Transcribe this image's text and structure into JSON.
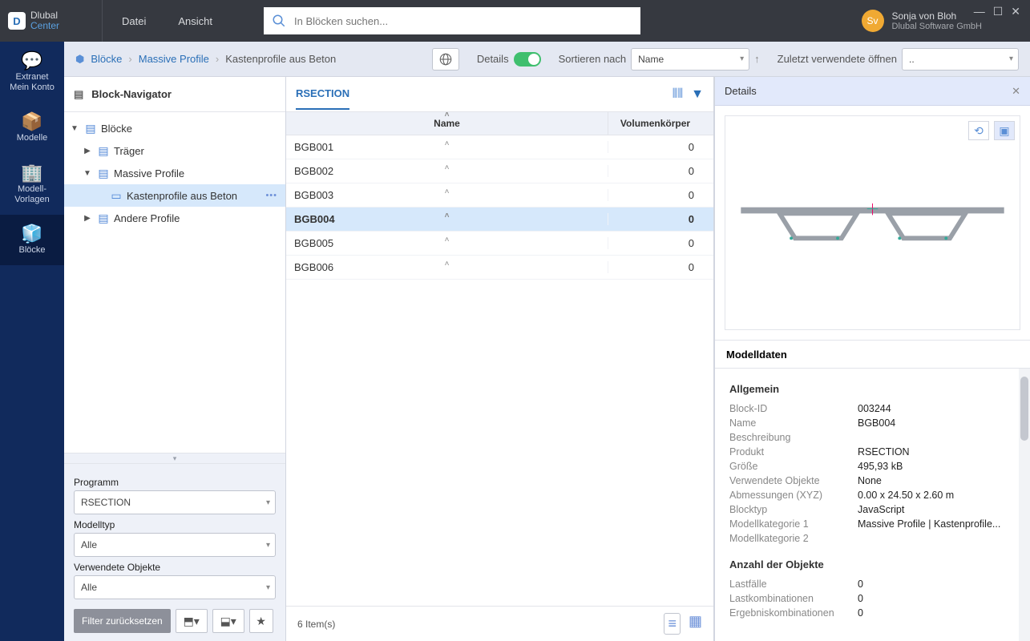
{
  "app": {
    "name": "Dlubal",
    "sub": "Center"
  },
  "menu": {
    "file": "Datei",
    "view": "Ansicht"
  },
  "search": {
    "placeholder": "In Blöcken suchen..."
  },
  "user": {
    "initials": "Sv",
    "name": "Sonja von Bloh",
    "company": "Dlubal Software GmbH"
  },
  "leftrail": [
    {
      "label": "Extranet\nMein Konto",
      "icon": "💬"
    },
    {
      "label": "Modelle",
      "icon": "📦"
    },
    {
      "label": "Modell-\nVorlagen",
      "icon": "🏢"
    },
    {
      "label": "Blöcke",
      "icon": "🧊",
      "active": true
    }
  ],
  "breadcrumbs": [
    "Blöcke",
    "Massive Profile",
    "Kastenprofile aus Beton"
  ],
  "subbar": {
    "details": "Details",
    "sort_label": "Sortieren nach",
    "sort_value": "Name",
    "recent_label": "Zuletzt verwendete öffnen",
    "recent_value": ".."
  },
  "navigator": {
    "title": "Block-Navigator",
    "tree": {
      "root": "Blöcke",
      "n1": "Träger",
      "n2": "Massive Profile",
      "n3": "Kastenprofile aus Beton",
      "n4": "Andere Profile"
    },
    "filters": {
      "program_label": "Programm",
      "program_value": "RSECTION",
      "modeltype_label": "Modelltyp",
      "modeltype_value": "Alle",
      "usedobj_label": "Verwendete Objekte",
      "usedobj_value": "Alle",
      "reset": "Filter zurücksetzen"
    }
  },
  "list": {
    "tab": "RSECTION",
    "col_name": "Name",
    "col_vol": "Volumenkörper",
    "rows": [
      {
        "name": "BGB001",
        "vol": "0"
      },
      {
        "name": "BGB002",
        "vol": "0"
      },
      {
        "name": "BGB003",
        "vol": "0"
      },
      {
        "name": "BGB004",
        "vol": "0",
        "selected": true
      },
      {
        "name": "BGB005",
        "vol": "0"
      },
      {
        "name": "BGB006",
        "vol": "0"
      }
    ],
    "footer": "6 Item(s)"
  },
  "details": {
    "title": "Details",
    "model_head": "Modelldaten",
    "section_general": "Allgemein",
    "general": [
      {
        "k": "Block-ID",
        "v": "003244"
      },
      {
        "k": "Name",
        "v": "BGB004"
      },
      {
        "k": "Beschreibung",
        "v": ""
      },
      {
        "k": "Produkt",
        "v": "RSECTION"
      },
      {
        "k": "Größe",
        "v": "495,93 kB"
      },
      {
        "k": "Verwendete Objekte",
        "v": "None"
      },
      {
        "k": "Abmessungen (XYZ)",
        "v": "0.00 x 24.50 x 2.60 m"
      },
      {
        "k": "Blocktyp",
        "v": "JavaScript"
      },
      {
        "k": "Modellkategorie 1",
        "v": "Massive Profile | Kastenprofile..."
      },
      {
        "k": "Modellkategorie 2",
        "v": ""
      }
    ],
    "section_count": "Anzahl der Objekte",
    "counts": [
      {
        "k": "Lastfälle",
        "v": "0"
      },
      {
        "k": "Lastkombinationen",
        "v": "0"
      },
      {
        "k": "Ergebniskombinationen",
        "v": "0"
      }
    ]
  }
}
